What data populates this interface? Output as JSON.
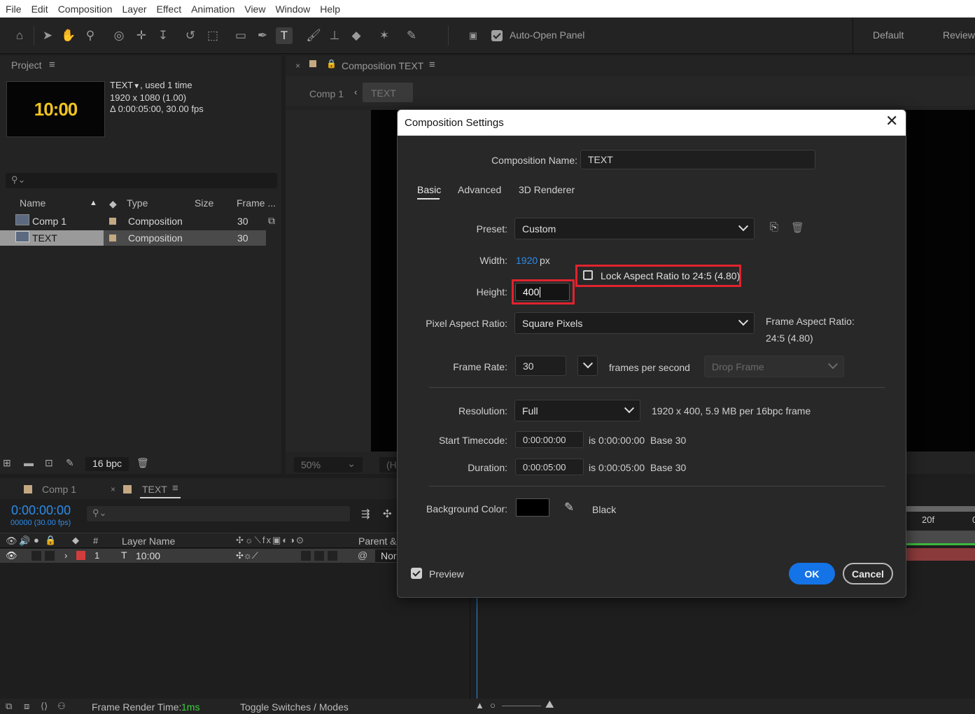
{
  "menubar": [
    "File",
    "Edit",
    "Composition",
    "Layer",
    "Effect",
    "Animation",
    "View",
    "Window",
    "Help"
  ],
  "toolbar": {
    "auto_open_label": "Auto-Open Panel",
    "workspaces": [
      "Default",
      "Review"
    ]
  },
  "project": {
    "title": "Project",
    "thumb_text": "10:00",
    "info_name": "TEXT",
    "info_used": ", used 1 time",
    "info_size": "1920 x 1080 (1.00)",
    "info_duration": "Δ 0:00:05:00, 30.00 fps",
    "search_placeholder": "",
    "columns": [
      "Name",
      "Type",
      "Size",
      "Frame ..."
    ],
    "rows": [
      {
        "name": "Comp 1",
        "type": "Composition",
        "frame": "30"
      },
      {
        "name": "TEXT",
        "type": "Composition",
        "frame": "30"
      }
    ],
    "bpc": "16 bpc"
  },
  "viewer": {
    "tab_label": "Composition TEXT",
    "crumbs": [
      "Comp 1",
      "TEXT"
    ],
    "zoom": "50%",
    "partial": "(H"
  },
  "timeline": {
    "tabs": [
      "Comp 1",
      "TEXT"
    ],
    "timecode": "0:00:00:00",
    "frames": "00000 (30.00 fps)",
    "col_num": "#",
    "col_layer": "Layer Name",
    "col_parent": "Parent &",
    "layer": {
      "num": "1",
      "name": "10:00",
      "mode": "Nor"
    },
    "ruler": [
      "20f",
      "0"
    ],
    "status_label": "Frame Render Time:",
    "status_value": "1ms",
    "toggle_label": "Toggle Switches / Modes"
  },
  "dialog": {
    "title": "Composition Settings",
    "name_label": "Composition Name:",
    "name_value": "TEXT",
    "tabs": [
      "Basic",
      "Advanced",
      "3D Renderer"
    ],
    "preset_label": "Preset:",
    "preset_value": "Custom",
    "width_label": "Width:",
    "width_value": "1920",
    "px": "px",
    "lock_label": "Lock Aspect Ratio to 24:5 (4.80)",
    "height_label": "Height:",
    "height_value": "400",
    "par_label": "Pixel Aspect Ratio:",
    "par_value": "Square Pixels",
    "far_label": "Frame Aspect Ratio:",
    "far_value": "24:5 (4.80)",
    "fr_label": "Frame Rate:",
    "fr_value": "30",
    "fps_label": "frames per second",
    "drop_frame": "Drop Frame",
    "res_label": "Resolution:",
    "res_value": "Full",
    "res_info": "1920 x 400, 5.9 MB per 16bpc frame",
    "start_label": "Start Timecode:",
    "start_value": "0:00:00:00",
    "start_info": "is 0:00:00:00  Base 30",
    "dur_label": "Duration:",
    "dur_value": "0:00:05:00",
    "dur_info": "is 0:00:05:00  Base 30",
    "bg_label": "Background Color:",
    "bg_name": "Black",
    "preview_label": "Preview",
    "ok": "OK",
    "cancel": "Cancel",
    "accent": "#1473e6",
    "highlight": "#e0232e"
  }
}
